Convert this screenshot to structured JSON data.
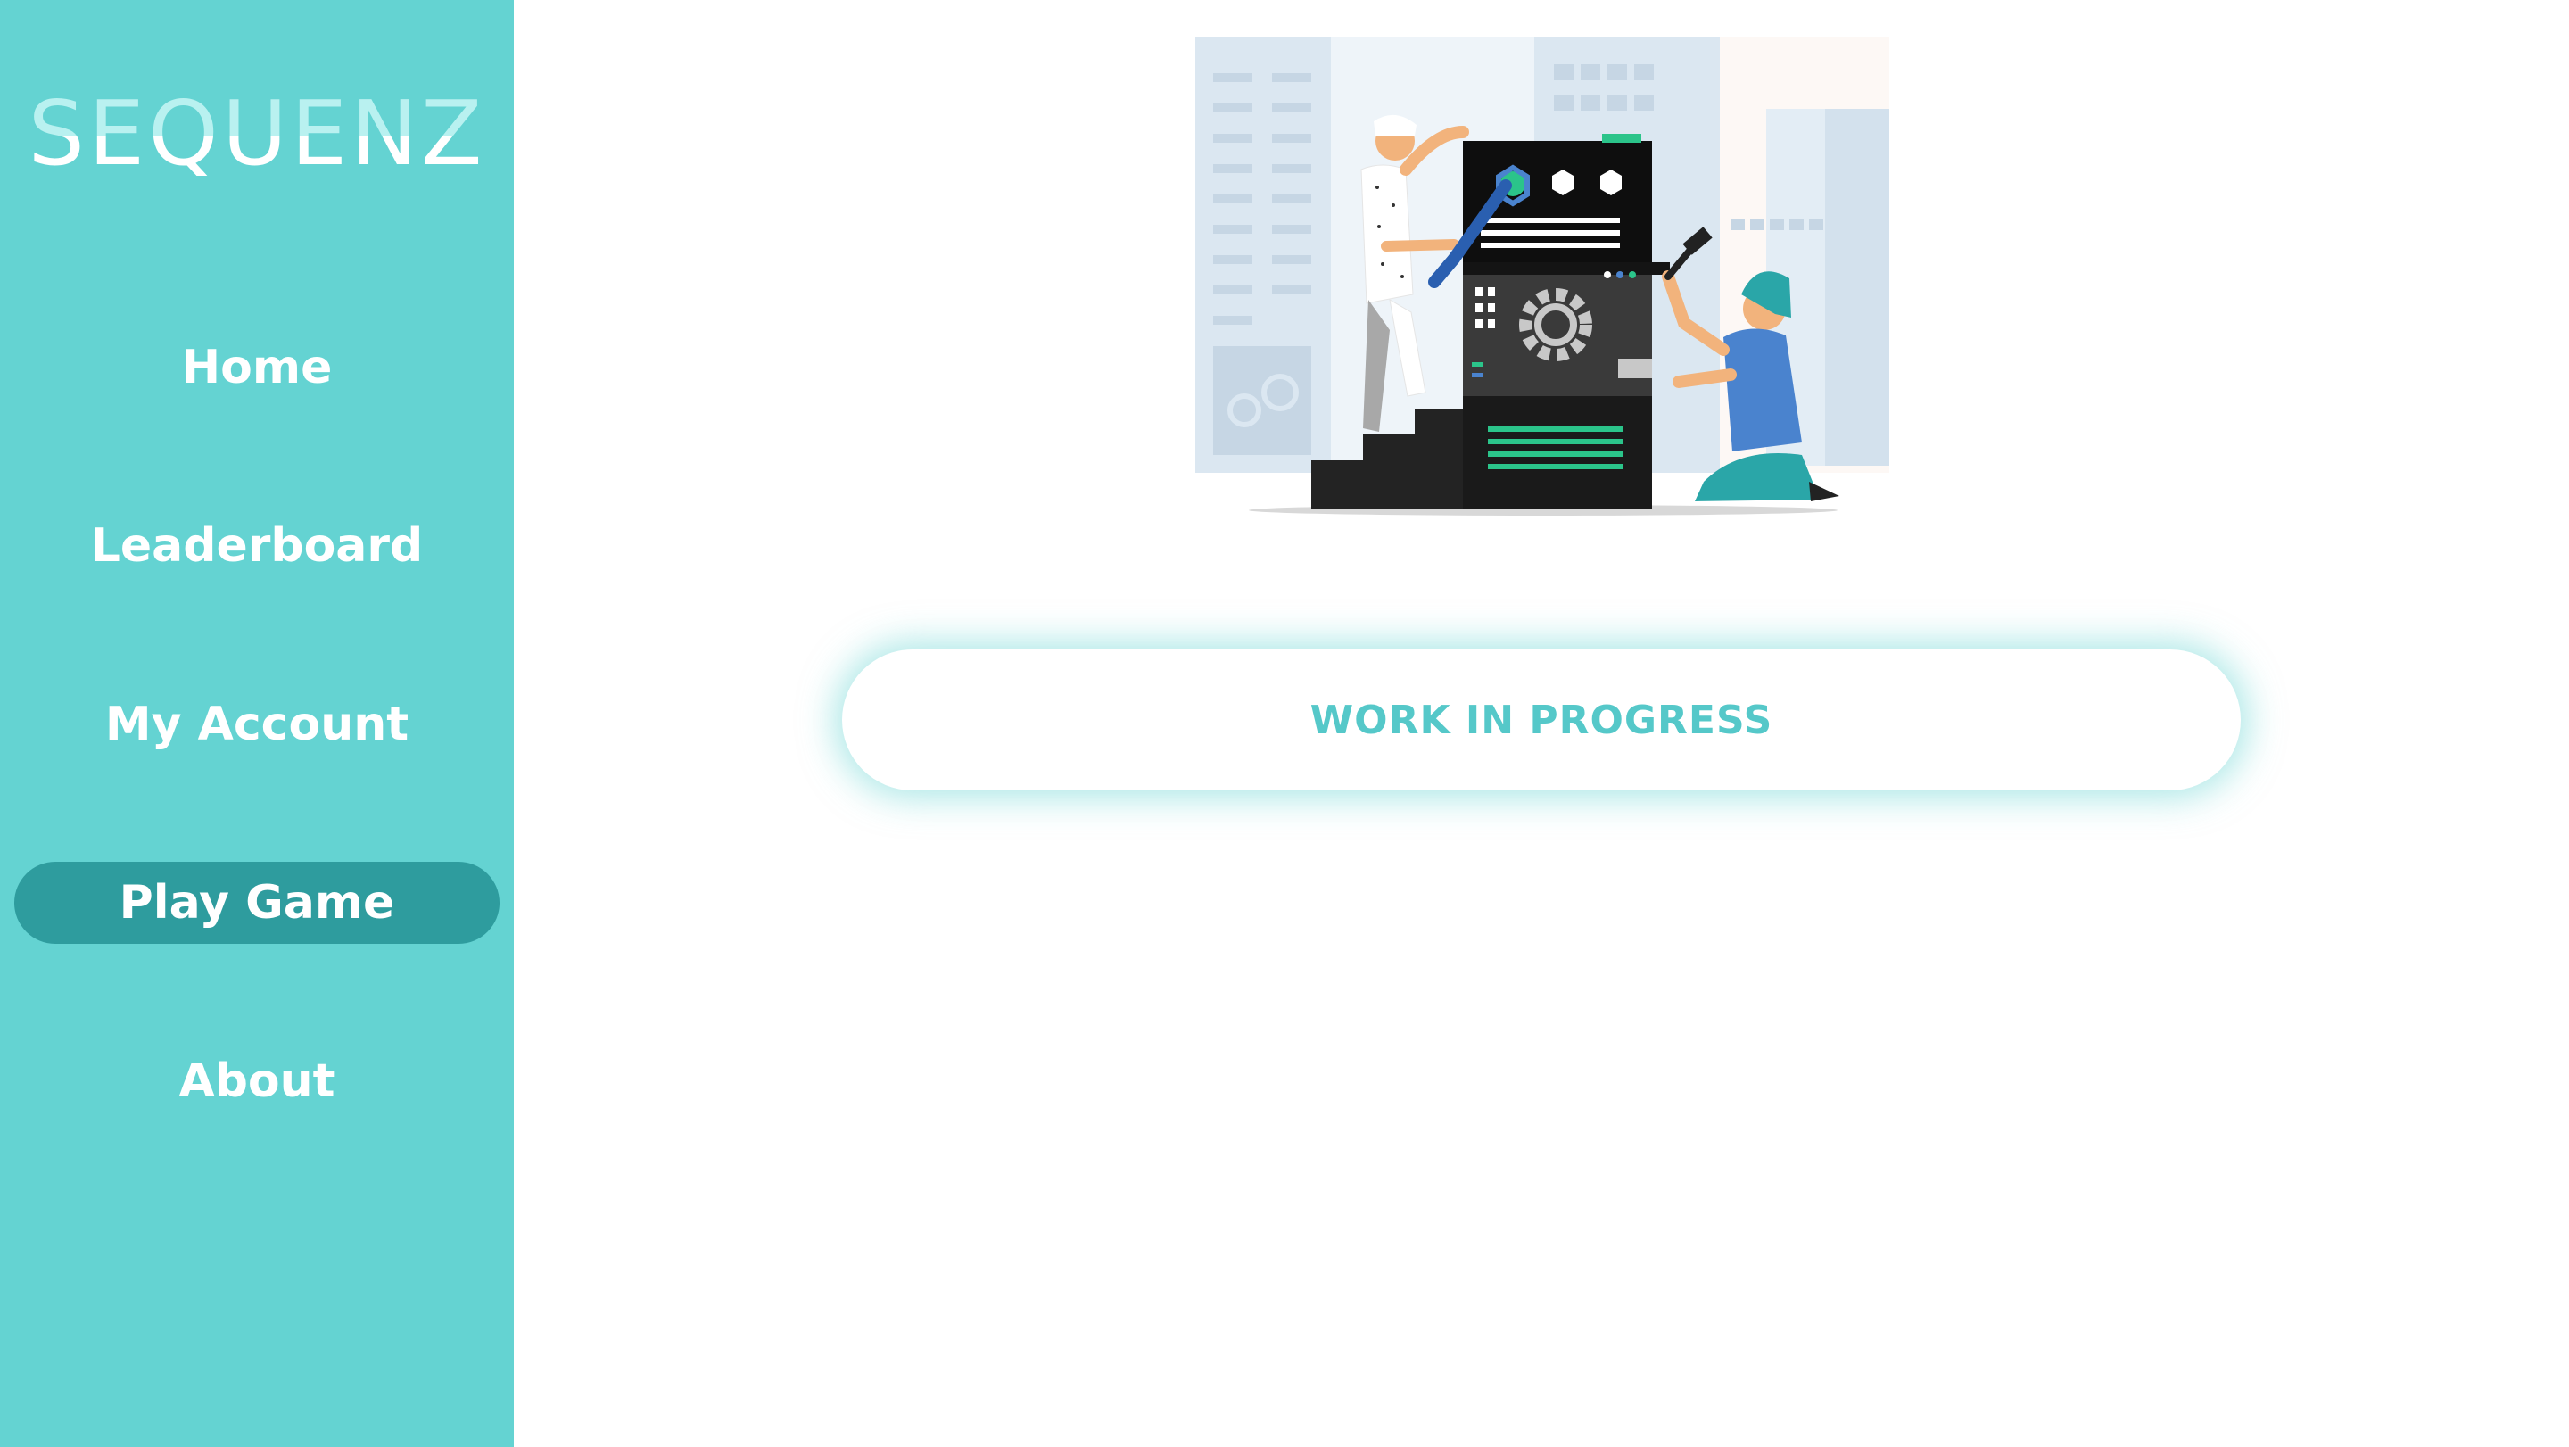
{
  "app": {
    "logo_text": "SEQUENZ"
  },
  "sidebar": {
    "items": [
      {
        "label": "Home",
        "active": false
      },
      {
        "label": "Leaderboard",
        "active": false
      },
      {
        "label": "My Account",
        "active": false
      },
      {
        "label": "Play Game",
        "active": true
      },
      {
        "label": "About",
        "active": false
      }
    ]
  },
  "main": {
    "status_message": "WORK IN PROGRESS",
    "illustration_icon": "construction-illustration"
  },
  "colors": {
    "sidebar_bg": "#64d3d2",
    "active_item_bg": "#2e9c9e",
    "accent_text": "#55c8c9",
    "page_bg": "#ffffff"
  }
}
